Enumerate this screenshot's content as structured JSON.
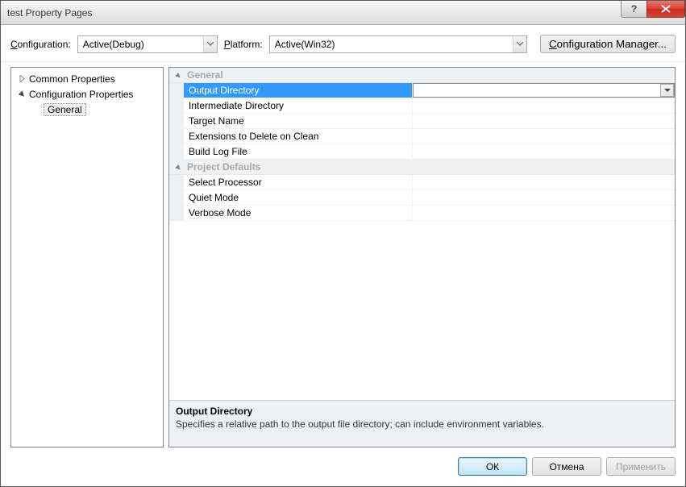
{
  "window": {
    "title": "test Property Pages"
  },
  "toolbar": {
    "configuration_label": "Configuration:",
    "configuration_value": "Active(Debug)",
    "platform_label": "Platform:",
    "platform_value": "Active(Win32)",
    "config_manager_label": "Configuration Manager..."
  },
  "tree": {
    "items": [
      {
        "label": "Common Properties",
        "expanded": false
      },
      {
        "label": "Configuration Properties",
        "expanded": true,
        "children": [
          {
            "label": "General",
            "selected": true
          }
        ]
      }
    ]
  },
  "grid": {
    "sections": [
      {
        "label": "General",
        "items": [
          {
            "name": "Output Directory",
            "selected": true
          },
          {
            "name": "Intermediate Directory"
          },
          {
            "name": "Target Name"
          },
          {
            "name": "Extensions to Delete on Clean"
          },
          {
            "name": "Build Log File"
          }
        ]
      },
      {
        "label": "Project Defaults",
        "items": [
          {
            "name": "Select Processor"
          },
          {
            "name": "Quiet Mode"
          },
          {
            "name": "Verbose Mode"
          }
        ]
      }
    ]
  },
  "description": {
    "title": "Output Directory",
    "text": "Specifies a relative path to the output file directory; can include environment variables."
  },
  "footer": {
    "ok": "ОК",
    "cancel": "Отмена",
    "apply": "Применить"
  }
}
